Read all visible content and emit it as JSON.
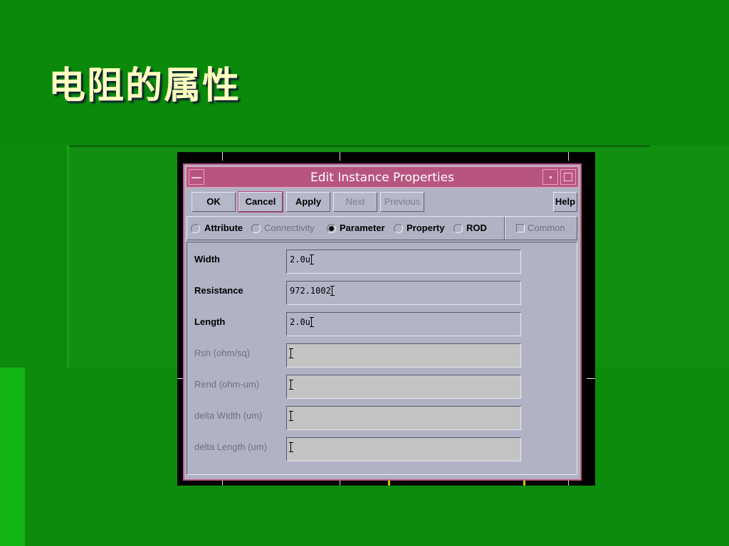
{
  "slide": {
    "title": "电阻的属性"
  },
  "dialog": {
    "title": "Edit Instance Properties",
    "buttons": {
      "ok": "OK",
      "cancel": "Cancel",
      "apply": "Apply",
      "next": "Next",
      "previous": "Previous",
      "help": "Help"
    },
    "tabs": [
      {
        "label": "Attribute",
        "selected": false,
        "enabled": true
      },
      {
        "label": "Connectivity",
        "selected": false,
        "enabled": false
      },
      {
        "label": "Parameter",
        "selected": true,
        "enabled": true
      },
      {
        "label": "Property",
        "selected": false,
        "enabled": true
      },
      {
        "label": "ROD",
        "selected": false,
        "enabled": true
      }
    ],
    "common_checkbox": {
      "label": "Common",
      "checked": false,
      "enabled": false
    },
    "fields": [
      {
        "label": "Width",
        "value": "2.0u",
        "enabled": true
      },
      {
        "label": "Resistance",
        "value": "972.1002",
        "enabled": true
      },
      {
        "label": "Length",
        "value": "2.0u",
        "enabled": true
      },
      {
        "label": "Rsh (ohm/sq)",
        "value": "",
        "enabled": false
      },
      {
        "label": "Rend (ohm-um)",
        "value": "",
        "enabled": false
      },
      {
        "label": "delta Width (um)",
        "value": "",
        "enabled": false
      },
      {
        "label": "delta Length (um)",
        "value": "",
        "enabled": false
      }
    ]
  },
  "colors": {
    "slide_background": "#0b8a0b",
    "title_text": "#ffffc0",
    "dialog_titlebar": "#b8557f",
    "dialog_body": "#b1b2c3",
    "disabled_field": "#c3c3c3"
  }
}
